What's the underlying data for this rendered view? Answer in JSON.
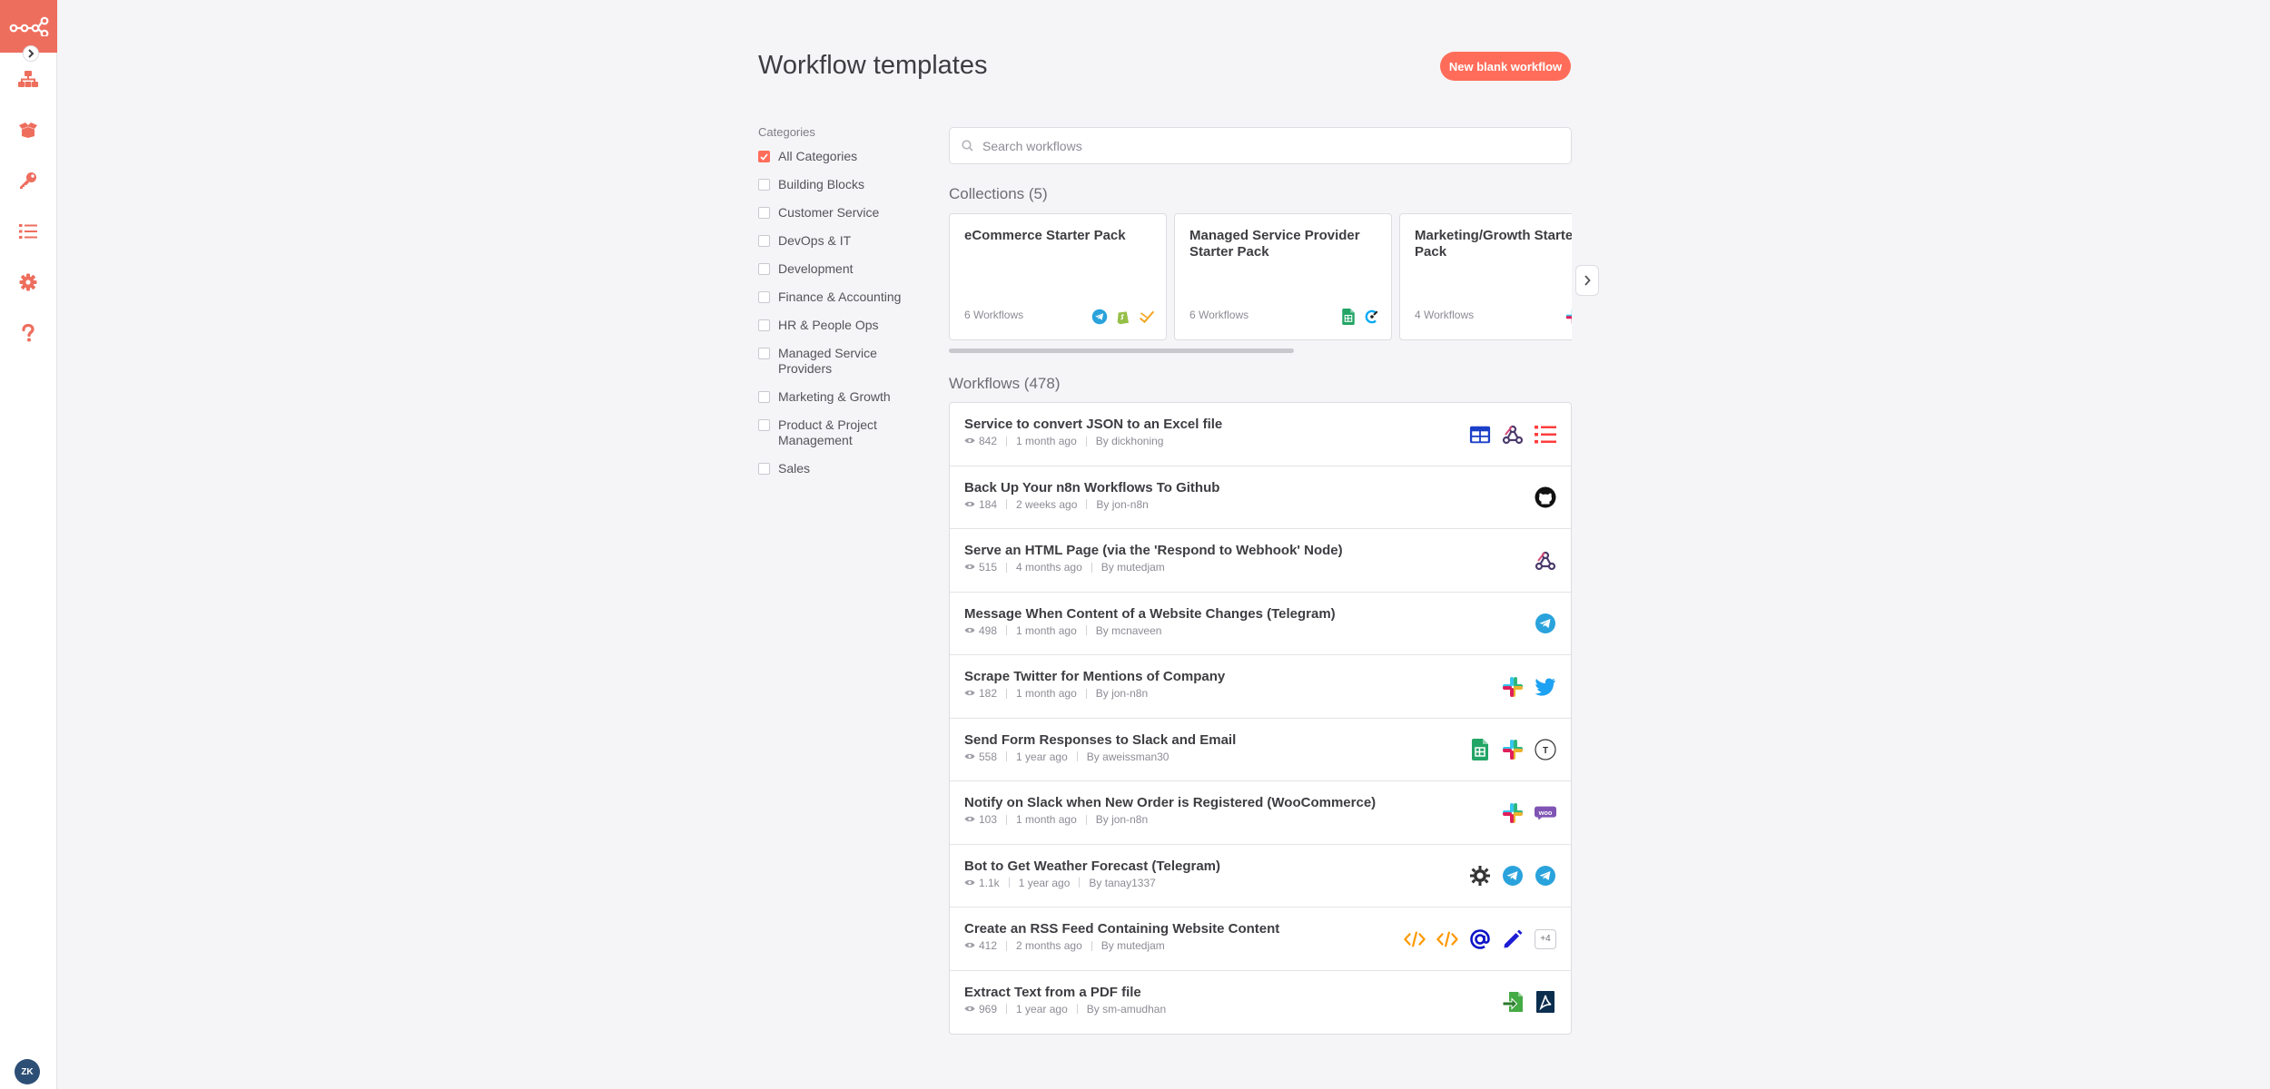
{
  "header": {
    "title": "Workflow templates",
    "new_button": "New blank workflow"
  },
  "categories": {
    "label": "Categories",
    "items": [
      {
        "label": "All Categories",
        "checked": true
      },
      {
        "label": "Building Blocks"
      },
      {
        "label": "Customer Service"
      },
      {
        "label": "DevOps & IT"
      },
      {
        "label": "Development"
      },
      {
        "label": "Finance & Accounting"
      },
      {
        "label": "HR & People Ops"
      },
      {
        "label": "Managed Service Providers"
      },
      {
        "label": "Marketing & Growth"
      },
      {
        "label": "Product & Project Management"
      },
      {
        "label": "Sales"
      }
    ]
  },
  "search": {
    "placeholder": "Search workflows"
  },
  "collections": {
    "title": "Collections (5)",
    "items": [
      {
        "name": "eCommerce Starter Pack",
        "count": "6 Workflows",
        "icons": [
          "telegram-icon",
          "shopify-icon",
          "zap-icon"
        ]
      },
      {
        "name": "Managed Service Provider Starter Pack",
        "count": "6 Workflows",
        "icons": [
          "google-sheets-icon",
          "clockify-icon"
        ]
      },
      {
        "name": "Marketing/Growth Starter Pack",
        "count": "4 Workflows",
        "icons": [
          "slack-icon",
          "hubspot-icon"
        ]
      }
    ]
  },
  "workflows": {
    "title": "Workflows (478)",
    "items": [
      {
        "name": "Service to convert JSON to an Excel file",
        "views": "842",
        "age": "1 month ago",
        "author": "By dickhoning",
        "icons": [
          "spreadsheet-icon",
          "webhook-icon",
          "item-lists-icon"
        ]
      },
      {
        "name": "Back Up Your n8n Workflows To Github",
        "views": "184",
        "age": "2 weeks ago",
        "author": "By jon-n8n",
        "icons": [
          "github-icon"
        ]
      },
      {
        "name": "Serve an HTML Page (via the 'Respond to Webhook' Node)",
        "views": "515",
        "age": "4 months ago",
        "author": "By mutedjam",
        "icons": [
          "webhook-icon"
        ]
      },
      {
        "name": "Message When Content of a Website Changes (Telegram)",
        "views": "498",
        "age": "1 month ago",
        "author": "By mcnaveen",
        "icons": [
          "telegram-icon"
        ]
      },
      {
        "name": "Scrape Twitter for Mentions of Company",
        "views": "182",
        "age": "1 month ago",
        "author": "By jon-n8n",
        "icons": [
          "slack-icon",
          "twitter-icon"
        ]
      },
      {
        "name": "Send Form Responses to Slack and Email",
        "views": "558",
        "age": "1 year ago",
        "author": "By aweissman30",
        "icons": [
          "google-sheets-icon",
          "slack-icon",
          "typeform-icon"
        ]
      },
      {
        "name": "Notify on Slack when New Order is Registered (WooCommerce)",
        "views": "103",
        "age": "1 month ago",
        "author": "By jon-n8n",
        "icons": [
          "slack-icon",
          "woocommerce-icon"
        ]
      },
      {
        "name": "Bot to Get Weather Forecast (Telegram)",
        "views": "1.1k",
        "age": "1 year ago",
        "author": "By tanay1337",
        "icons": [
          "openweathermap-icon",
          "telegram-icon",
          "telegram-icon"
        ]
      },
      {
        "name": "Create an RSS Feed Containing Website Content",
        "views": "412",
        "age": "2 months ago",
        "author": "By mutedjam",
        "icons": [
          "html-extract-icon",
          "html-extract-icon",
          "email-icon",
          "edit-pencil-icon"
        ],
        "more": "+4"
      },
      {
        "name": "Extract Text from a PDF file",
        "views": "969",
        "age": "1 year ago",
        "author": "By sm-amudhan",
        "icons": [
          "read-binary-file-icon",
          "pdf-icon"
        ]
      }
    ]
  },
  "user": {
    "initials": "ZK"
  },
  "colors": {
    "accent": "#ff6d5a",
    "rail_icon": "#ee6e5e"
  }
}
